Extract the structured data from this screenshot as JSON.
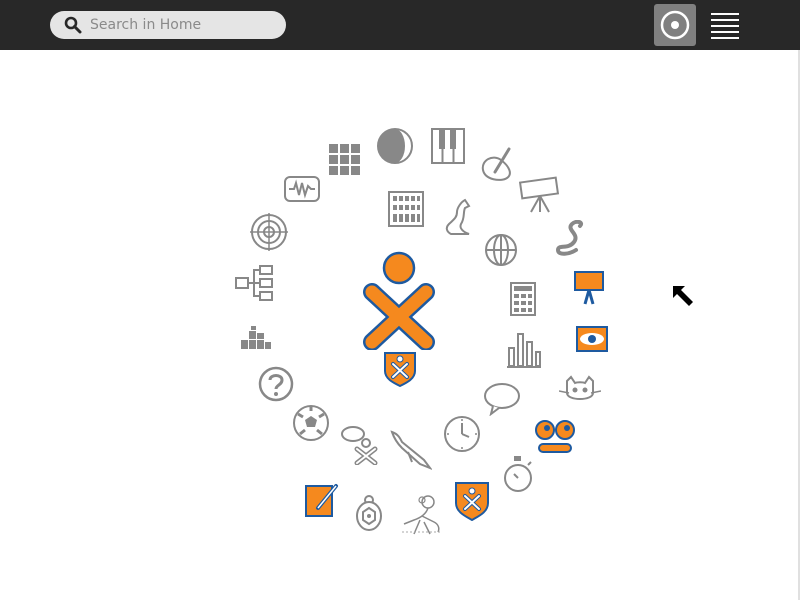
{
  "toolbar": {
    "search_placeholder": "Search in Home",
    "view_button": "home-view",
    "menu_button": "menu"
  },
  "ring": {
    "center_icon": "xo-buddy-icon",
    "activities": [
      "grid-icon",
      "moon-icon",
      "piano-icon",
      "paint-icon",
      "telescope-icon",
      "waveform-icon",
      "abacus-icon",
      "kangaroo-icon",
      "snake-icon",
      "target-icon",
      "globe-icon",
      "calculator-icon",
      "presentation-icon",
      "hierarchy-icon",
      "bar-chart-icon",
      "eye-icon",
      "blocks-icon",
      "help-icon",
      "xo-shield-icon",
      "speech-bubble-icon",
      "cat-icon",
      "soccer-ball-icon",
      "chat-xo-icon",
      "bird-icon",
      "clock-icon",
      "eyes-icon",
      "stopwatch-icon",
      "write-icon",
      "turtle-icon",
      "physics-icon",
      "shield-icon"
    ]
  },
  "colors": {
    "toolbar_bg": "#282828",
    "accent_orange": "#f5891e",
    "accent_blue": "#1e5aa0",
    "icon_gray": "#888888"
  }
}
